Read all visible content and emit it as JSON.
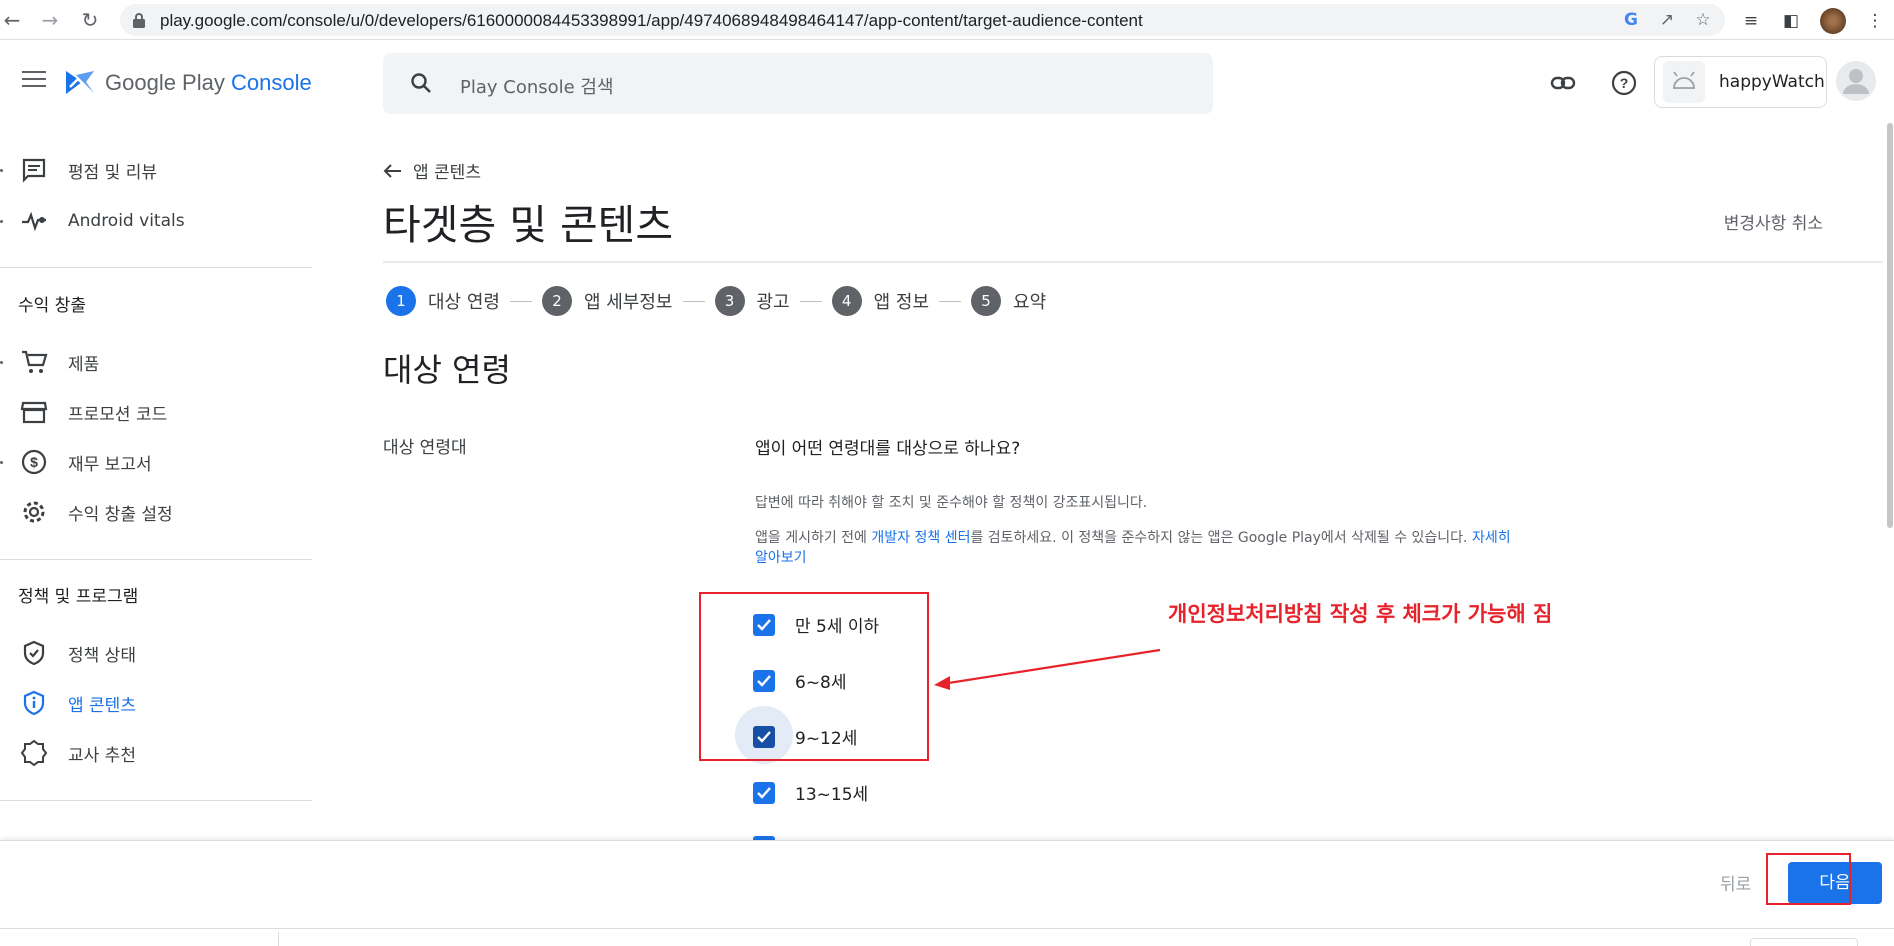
{
  "browser": {
    "url": "play.google.com/console/u/0/developers/6160000084453398991/app/4974068948498464147/app-content/target-audience-content"
  },
  "header": {
    "logo_main": "Google Play ",
    "logo_accent": "Console",
    "search_placeholder": "Play Console 검색",
    "account_name": "happyWatch"
  },
  "sidebar": {
    "items_top": [
      {
        "label": "평점 및 리뷰",
        "icon": "review-icon"
      },
      {
        "label": "Android vitals",
        "icon": "vitals-icon"
      }
    ],
    "section_monetize": "수익 창출",
    "items_monetize": [
      {
        "label": "제품",
        "icon": "cart-icon"
      },
      {
        "label": "프로모션 코드",
        "icon": "store-icon"
      },
      {
        "label": "재무 보고서",
        "icon": "dollar-icon"
      },
      {
        "label": "수익 창출 설정",
        "icon": "gear-icon"
      }
    ],
    "section_policy": "정책 및 프로그램",
    "items_policy": [
      {
        "label": "정책 상태",
        "icon": "shield-check-icon"
      },
      {
        "label": "앱 콘텐츠",
        "icon": "shield-info-icon",
        "active": true
      },
      {
        "label": "교사 추천",
        "icon": "badge-icon"
      }
    ]
  },
  "main": {
    "back_label": "앱 콘텐츠",
    "title": "타겟층 및 콘텐츠",
    "discard_label": "변경사항 취소",
    "steps": [
      {
        "num": "1",
        "label": "대상 연령",
        "active": true
      },
      {
        "num": "2",
        "label": "앱 세부정보"
      },
      {
        "num": "3",
        "label": "광고"
      },
      {
        "num": "4",
        "label": "앱 정보"
      },
      {
        "num": "5",
        "label": "요약"
      }
    ],
    "section_title": "대상 연령",
    "field_label": "대상 연령대",
    "question": "앱이 어떤 연령대를 대상으로 하나요?",
    "helper": "답변에 따라 취해야 할 조치 및 준수해야 할 정책이 강조표시됩니다.",
    "policy_before": "앱을 게시하기 전에 ",
    "policy_link": "개발자 정책 센터",
    "policy_after": "를 검토하세요. 이 정책을 준수하지 않는 앱은 Google Play에서 삭제될 수 있습니다. ",
    "learn_more": "자세히 알아보기",
    "age_options": [
      {
        "label": "만 5세 이하",
        "checked": true
      },
      {
        "label": "6~8세",
        "checked": true
      },
      {
        "label": "9~12세",
        "checked": true
      },
      {
        "label": "13~15세",
        "checked": true
      }
    ],
    "annotation": "개인정보처리방침 작성 후 체크가 가능해 짐"
  },
  "footer": {
    "back_label": "뒤로",
    "next_label": "다음"
  },
  "colors": {
    "accent": "#1a73e8",
    "annotation": "#e8222a"
  }
}
